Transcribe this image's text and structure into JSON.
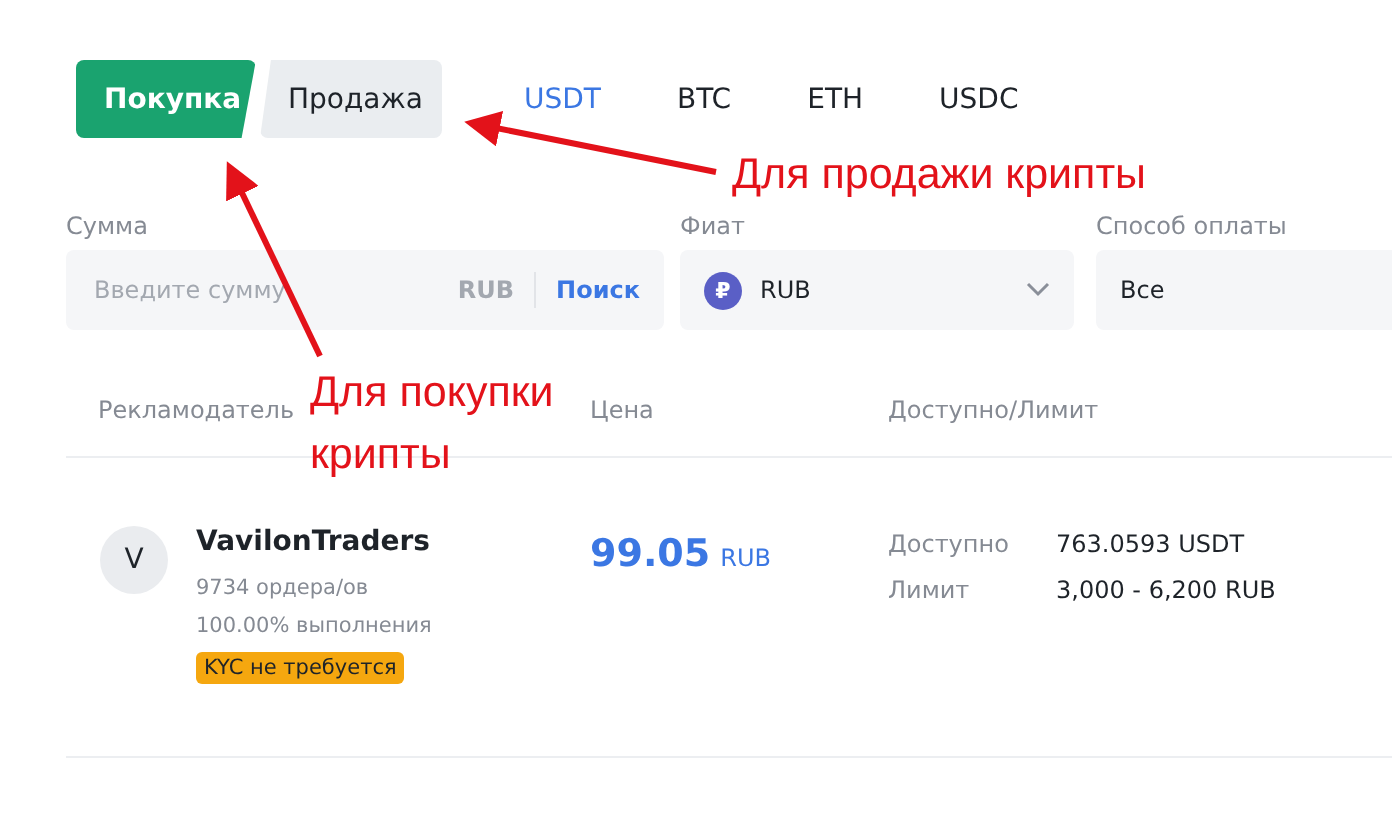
{
  "trade_tabs": [
    {
      "label": "Покупка",
      "selected": true
    },
    {
      "label": "Продажа",
      "selected": false
    }
  ],
  "coin_tabs": [
    {
      "label": "USDT",
      "selected": true
    },
    {
      "label": "BTC",
      "selected": false
    },
    {
      "label": "ETH",
      "selected": false
    },
    {
      "label": "USDC",
      "selected": false
    }
  ],
  "filters": {
    "amount": {
      "label": "Сумма",
      "placeholder": "Введите сумму",
      "currency": "RUB",
      "search": "Поиск"
    },
    "fiat": {
      "label": "Фиат",
      "icon_letter": "₽",
      "value": "RUB"
    },
    "payment": {
      "label": "Способ оплаты",
      "value": "Все"
    }
  },
  "table": {
    "columns": [
      "Рекламодатель",
      "Цена",
      "Доступно/Лимит"
    ],
    "rows": [
      {
        "avatar": "V",
        "name": "VavilonTraders",
        "orders": "9734 ордера/ов",
        "completion": "100.00% выполнения",
        "badge": "KYC не требуется",
        "price": "99.05",
        "price_currency": "RUB",
        "available_label": "Доступно",
        "available": "763.0593 USDT",
        "limit_label": "Лимит",
        "limit": "3,000 - 6,200 RUB"
      }
    ]
  },
  "annotations": [
    {
      "text": "Для продажи крипты"
    },
    {
      "text": "Для покупки крипты"
    }
  ]
}
